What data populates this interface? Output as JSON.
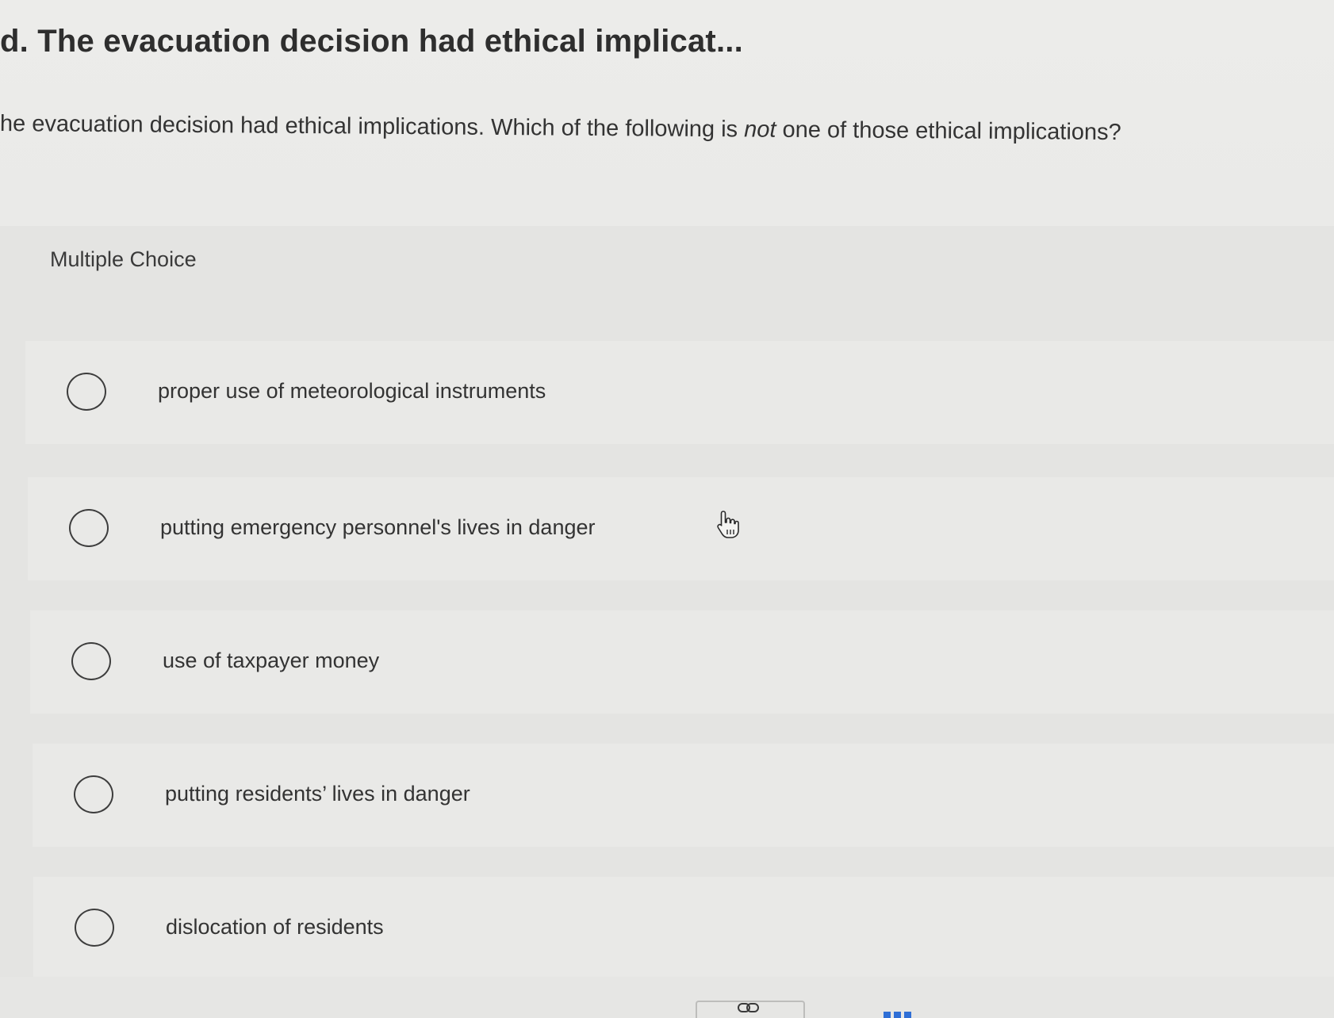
{
  "question": {
    "title": "d. The evacuation decision had ethical implicat...",
    "prompt_before": "he evacuation decision had ethical implications. Which of the following is ",
    "prompt_emphasis": "not",
    "prompt_after": " one of those ethical implications?"
  },
  "multiple_choice": {
    "label": "Multiple Choice",
    "options": [
      {
        "text": "proper use of meteorological instruments"
      },
      {
        "text": "putting emergency personnel's lives in danger"
      },
      {
        "text": "use of taxpayer money"
      },
      {
        "text": "putting residents’ lives in danger"
      },
      {
        "text": "dislocation of residents"
      }
    ]
  },
  "icons": {
    "cursor": "hand-pointer-icon",
    "link": "link-icon",
    "more": "more-options-icon"
  },
  "colors": {
    "radio_border": "#3d3d3d",
    "accent_blue": "#2f6fd6"
  }
}
